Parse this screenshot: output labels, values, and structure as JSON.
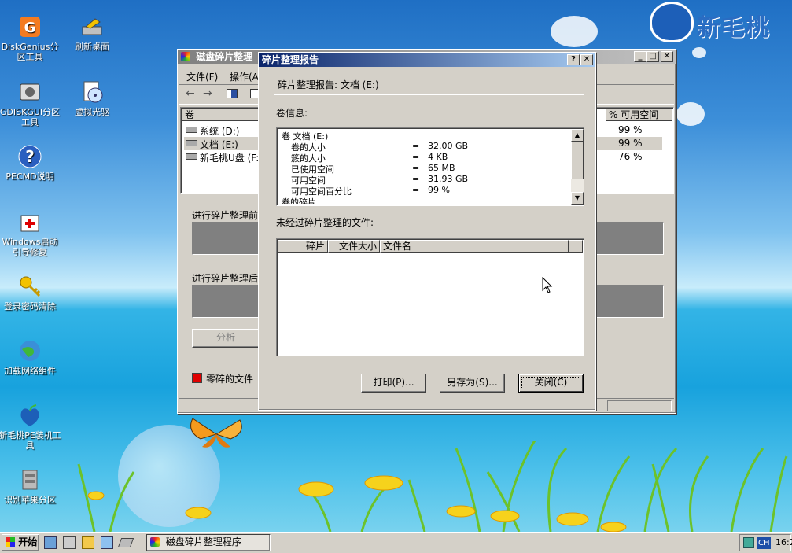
{
  "brand": {
    "name": "新毛桃"
  },
  "desktop_icons": [
    {
      "label": "DiskGenius分区工具",
      "icon": "diskgenius-icon"
    },
    {
      "label": "刷新桌面",
      "icon": "refresh-desktop-icon"
    },
    {
      "label": "GDISKGUI分区工具",
      "icon": "gdiskgui-icon"
    },
    {
      "label": "虚拟光驱",
      "icon": "virtual-drive-icon"
    },
    {
      "label": "PECMD说明",
      "icon": "help-icon"
    },
    {
      "label": "Windows启动引导修复",
      "icon": "boot-repair-icon"
    },
    {
      "label": "登录密码清除",
      "icon": "key-icon"
    },
    {
      "label": "加载网络组件",
      "icon": "network-icon"
    },
    {
      "label": "新毛桃PE装机工具",
      "icon": "installer-icon"
    },
    {
      "label": "识别苹果分区",
      "icon": "apple-partition-icon"
    }
  ],
  "main_window": {
    "title": "磁盘碎片整理",
    "menu": [
      "文件(F)",
      "操作(A"
    ],
    "columns": {
      "volume": "卷",
      "free_pct": "% 可用空间"
    },
    "volumes": [
      {
        "name": "系统 (D:)",
        "free_pct": "99 %"
      },
      {
        "name": "文档 (E:)",
        "free_pct": "99 %"
      },
      {
        "name": "新毛桃U盘 (F:",
        "free_pct": "76 %"
      }
    ],
    "before_label": "进行碎片整理前",
    "after_label": "进行碎片整理后",
    "analyze_button": "分析",
    "legend_fragmented": "零碎的文件"
  },
  "dialog": {
    "title": "碎片整理报告",
    "report_for": "碎片整理报告: 文档 (E:)",
    "volume_info_label": "卷信息:",
    "info_rows": [
      {
        "label": "卷 文档 (E:)",
        "eq": "",
        "value": "",
        "indent": false
      },
      {
        "label": "卷的大小",
        "eq": "=",
        "value": "32.00 GB",
        "indent": true
      },
      {
        "label": "簇的大小",
        "eq": "=",
        "value": "4 KB",
        "indent": true
      },
      {
        "label": "已使用空间",
        "eq": "=",
        "value": "65 MB",
        "indent": true
      },
      {
        "label": "可用空间",
        "eq": "=",
        "value": "31.93 GB",
        "indent": true
      },
      {
        "label": "可用空间百分比",
        "eq": "=",
        "value": "99 %",
        "indent": true
      },
      {
        "label": "卷的碎片",
        "eq": "",
        "value": "",
        "indent": false
      }
    ],
    "unfrag_label": "未经过碎片整理的文件:",
    "file_columns": [
      "碎片",
      "文件大小",
      "文件名"
    ],
    "print_button": "打印(P)...",
    "saveas_button": "另存为(S)...",
    "close_button": "关闭(C)"
  },
  "taskbar": {
    "start_label": "开始",
    "task_label": "磁盘碎片整理程序",
    "lang": "CH",
    "clock": "16:2"
  },
  "colors": {
    "fragmented": "#e00000",
    "title_active": "#0a246a"
  }
}
